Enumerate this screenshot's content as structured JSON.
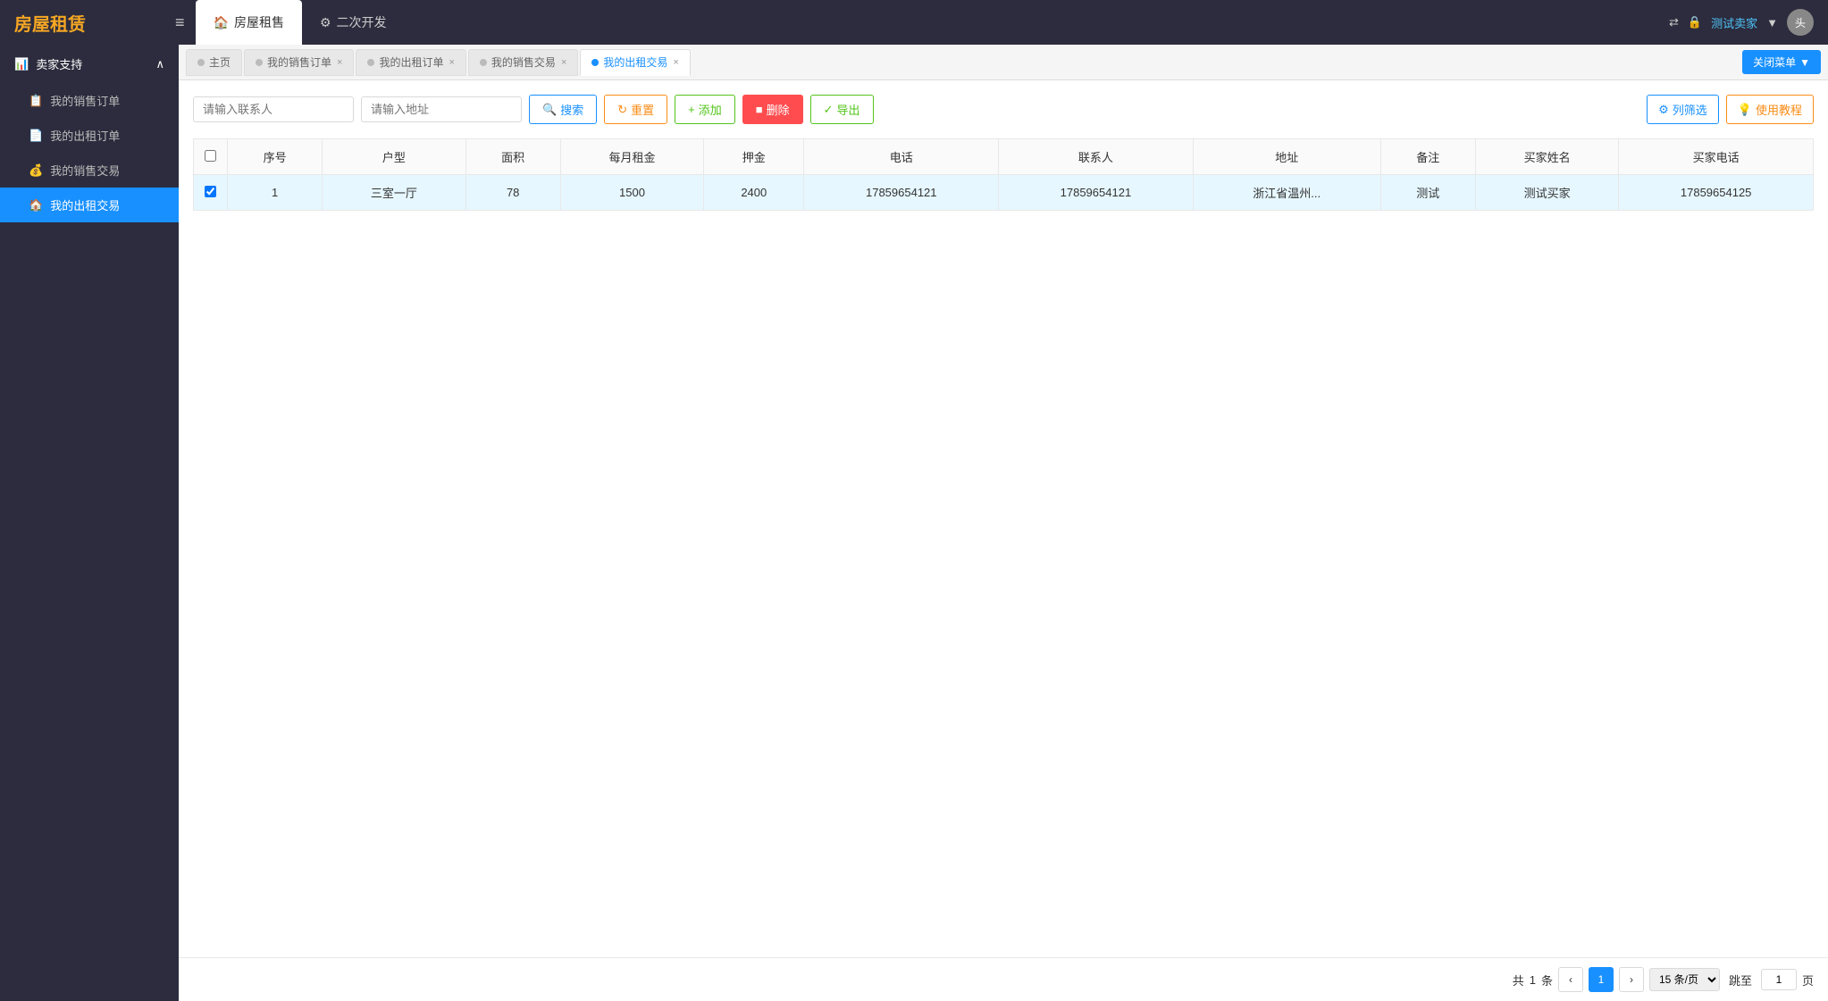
{
  "header": {
    "logo": "房屋租赁",
    "menu_icon": "≡",
    "nav_tabs": [
      {
        "label": "房屋租售",
        "icon": "🏠",
        "active": true
      },
      {
        "label": "二次开发",
        "icon": "⚙",
        "active": false
      }
    ],
    "icons": {
      "exchange": "⇄",
      "lock": "🔒"
    },
    "user_name": "测试卖家",
    "user_dropdown": "▼"
  },
  "tabs": [
    {
      "label": "主页",
      "dot": "gray",
      "closable": false,
      "active": false
    },
    {
      "label": "我的销售订单",
      "dot": "gray",
      "closable": true,
      "active": false
    },
    {
      "label": "我的出租订单",
      "dot": "gray",
      "closable": true,
      "active": false
    },
    {
      "label": "我的销售交易",
      "dot": "gray",
      "closable": true,
      "active": false
    },
    {
      "label": "我的出租交易",
      "dot": "blue",
      "closable": true,
      "active": true
    }
  ],
  "close_menu_btn": "关闭菜单",
  "sidebar": {
    "section_label": "卖家支持",
    "items": [
      {
        "label": "我的销售订单",
        "icon": "📋",
        "active": false
      },
      {
        "label": "我的出租订单",
        "icon": "📄",
        "active": false
      },
      {
        "label": "我的销售交易",
        "icon": "💰",
        "active": false
      },
      {
        "label": "我的出租交易",
        "icon": "🏠",
        "active": true
      }
    ]
  },
  "toolbar": {
    "contact_placeholder": "请输入联系人",
    "address_placeholder": "请输入地址",
    "search_label": "搜索",
    "reset_label": "重置",
    "add_label": "添加",
    "delete_label": "删除",
    "export_label": "导出",
    "filter_label": "列筛选",
    "tutorial_label": "使用教程"
  },
  "table": {
    "columns": [
      "序号",
      "户型",
      "面积",
      "每月租金",
      "押金",
      "电话",
      "联系人",
      "地址",
      "备注",
      "买家姓名",
      "买家电话"
    ],
    "rows": [
      {
        "index": "1",
        "house_type": "三室一厅",
        "area": "78",
        "monthly_rent": "1500",
        "deposit": "2400",
        "phone": "17859654121",
        "contact": "17859654121",
        "address": "浙江省温州...",
        "remark": "测试",
        "buyer_name": "测试买家",
        "buyer_phone": "17859654125"
      }
    ]
  },
  "pagination": {
    "total_label": "共",
    "total_count": "1",
    "total_unit": "条",
    "current_page": "1",
    "page_size_label": "15 条/页",
    "goto_label": "跳至",
    "page_unit": "页",
    "prev_icon": "‹",
    "next_icon": "›"
  }
}
